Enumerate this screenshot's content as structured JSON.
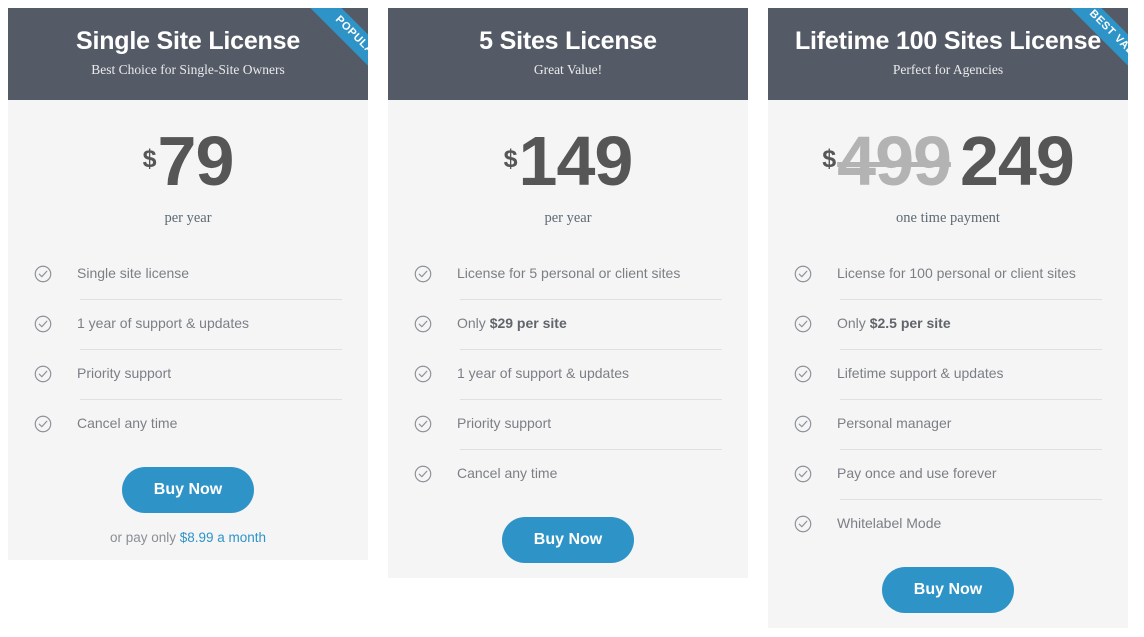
{
  "theme": {
    "header_bg": "#555b66",
    "card_bg": "#f5f5f5",
    "accent": "#2e94c8",
    "price_color": "#565656",
    "old_price_color": "#b3b3b3",
    "feature_text_color": "#7b7f85",
    "divider_color": "#e0e0e0"
  },
  "plans": [
    {
      "id": "single-site",
      "title": "Single Site License",
      "subtitle": "Best Choice for Single-Site Owners",
      "ribbon": "POPULAR",
      "currency": "$",
      "old_price": null,
      "price": "79",
      "period": "per year",
      "features": [
        {
          "text": "Single site license",
          "strong": null
        },
        {
          "text": "1 year of support & updates",
          "strong": null
        },
        {
          "text": "Priority support",
          "strong": null
        },
        {
          "text": "Cancel any time",
          "strong": null
        }
      ],
      "cta_label": "Buy Now",
      "note_prefix": "or pay only ",
      "note_link": "$8.99 a month"
    },
    {
      "id": "five-sites",
      "title": "5 Sites License",
      "subtitle": "Great Value!",
      "ribbon": null,
      "currency": "$",
      "old_price": null,
      "price": "149",
      "period": "per year",
      "features": [
        {
          "text": "License for 5 personal or client sites",
          "strong": null
        },
        {
          "text": "Only ",
          "strong": "$29 per site"
        },
        {
          "text": "1 year of support & updates",
          "strong": null
        },
        {
          "text": "Priority support",
          "strong": null
        },
        {
          "text": "Cancel any time",
          "strong": null
        }
      ],
      "cta_label": "Buy Now",
      "note_prefix": null,
      "note_link": null
    },
    {
      "id": "lifetime-100-sites",
      "title": "Lifetime 100 Sites License",
      "subtitle": "Perfect for Agencies",
      "ribbon": "BEST VALUE",
      "currency": "$",
      "old_price": "499",
      "price": "249",
      "period": "one time payment",
      "features": [
        {
          "text": "License for 100 personal or client sites",
          "strong": null
        },
        {
          "text": "Only ",
          "strong": "$2.5 per site"
        },
        {
          "text": "Lifetime support & updates",
          "strong": null
        },
        {
          "text": "Personal manager",
          "strong": null
        },
        {
          "text": "Pay once and use forever",
          "strong": null
        },
        {
          "text": "Whitelabel Mode",
          "strong": null
        }
      ],
      "cta_label": "Buy Now",
      "note_prefix": null,
      "note_link": null
    }
  ]
}
